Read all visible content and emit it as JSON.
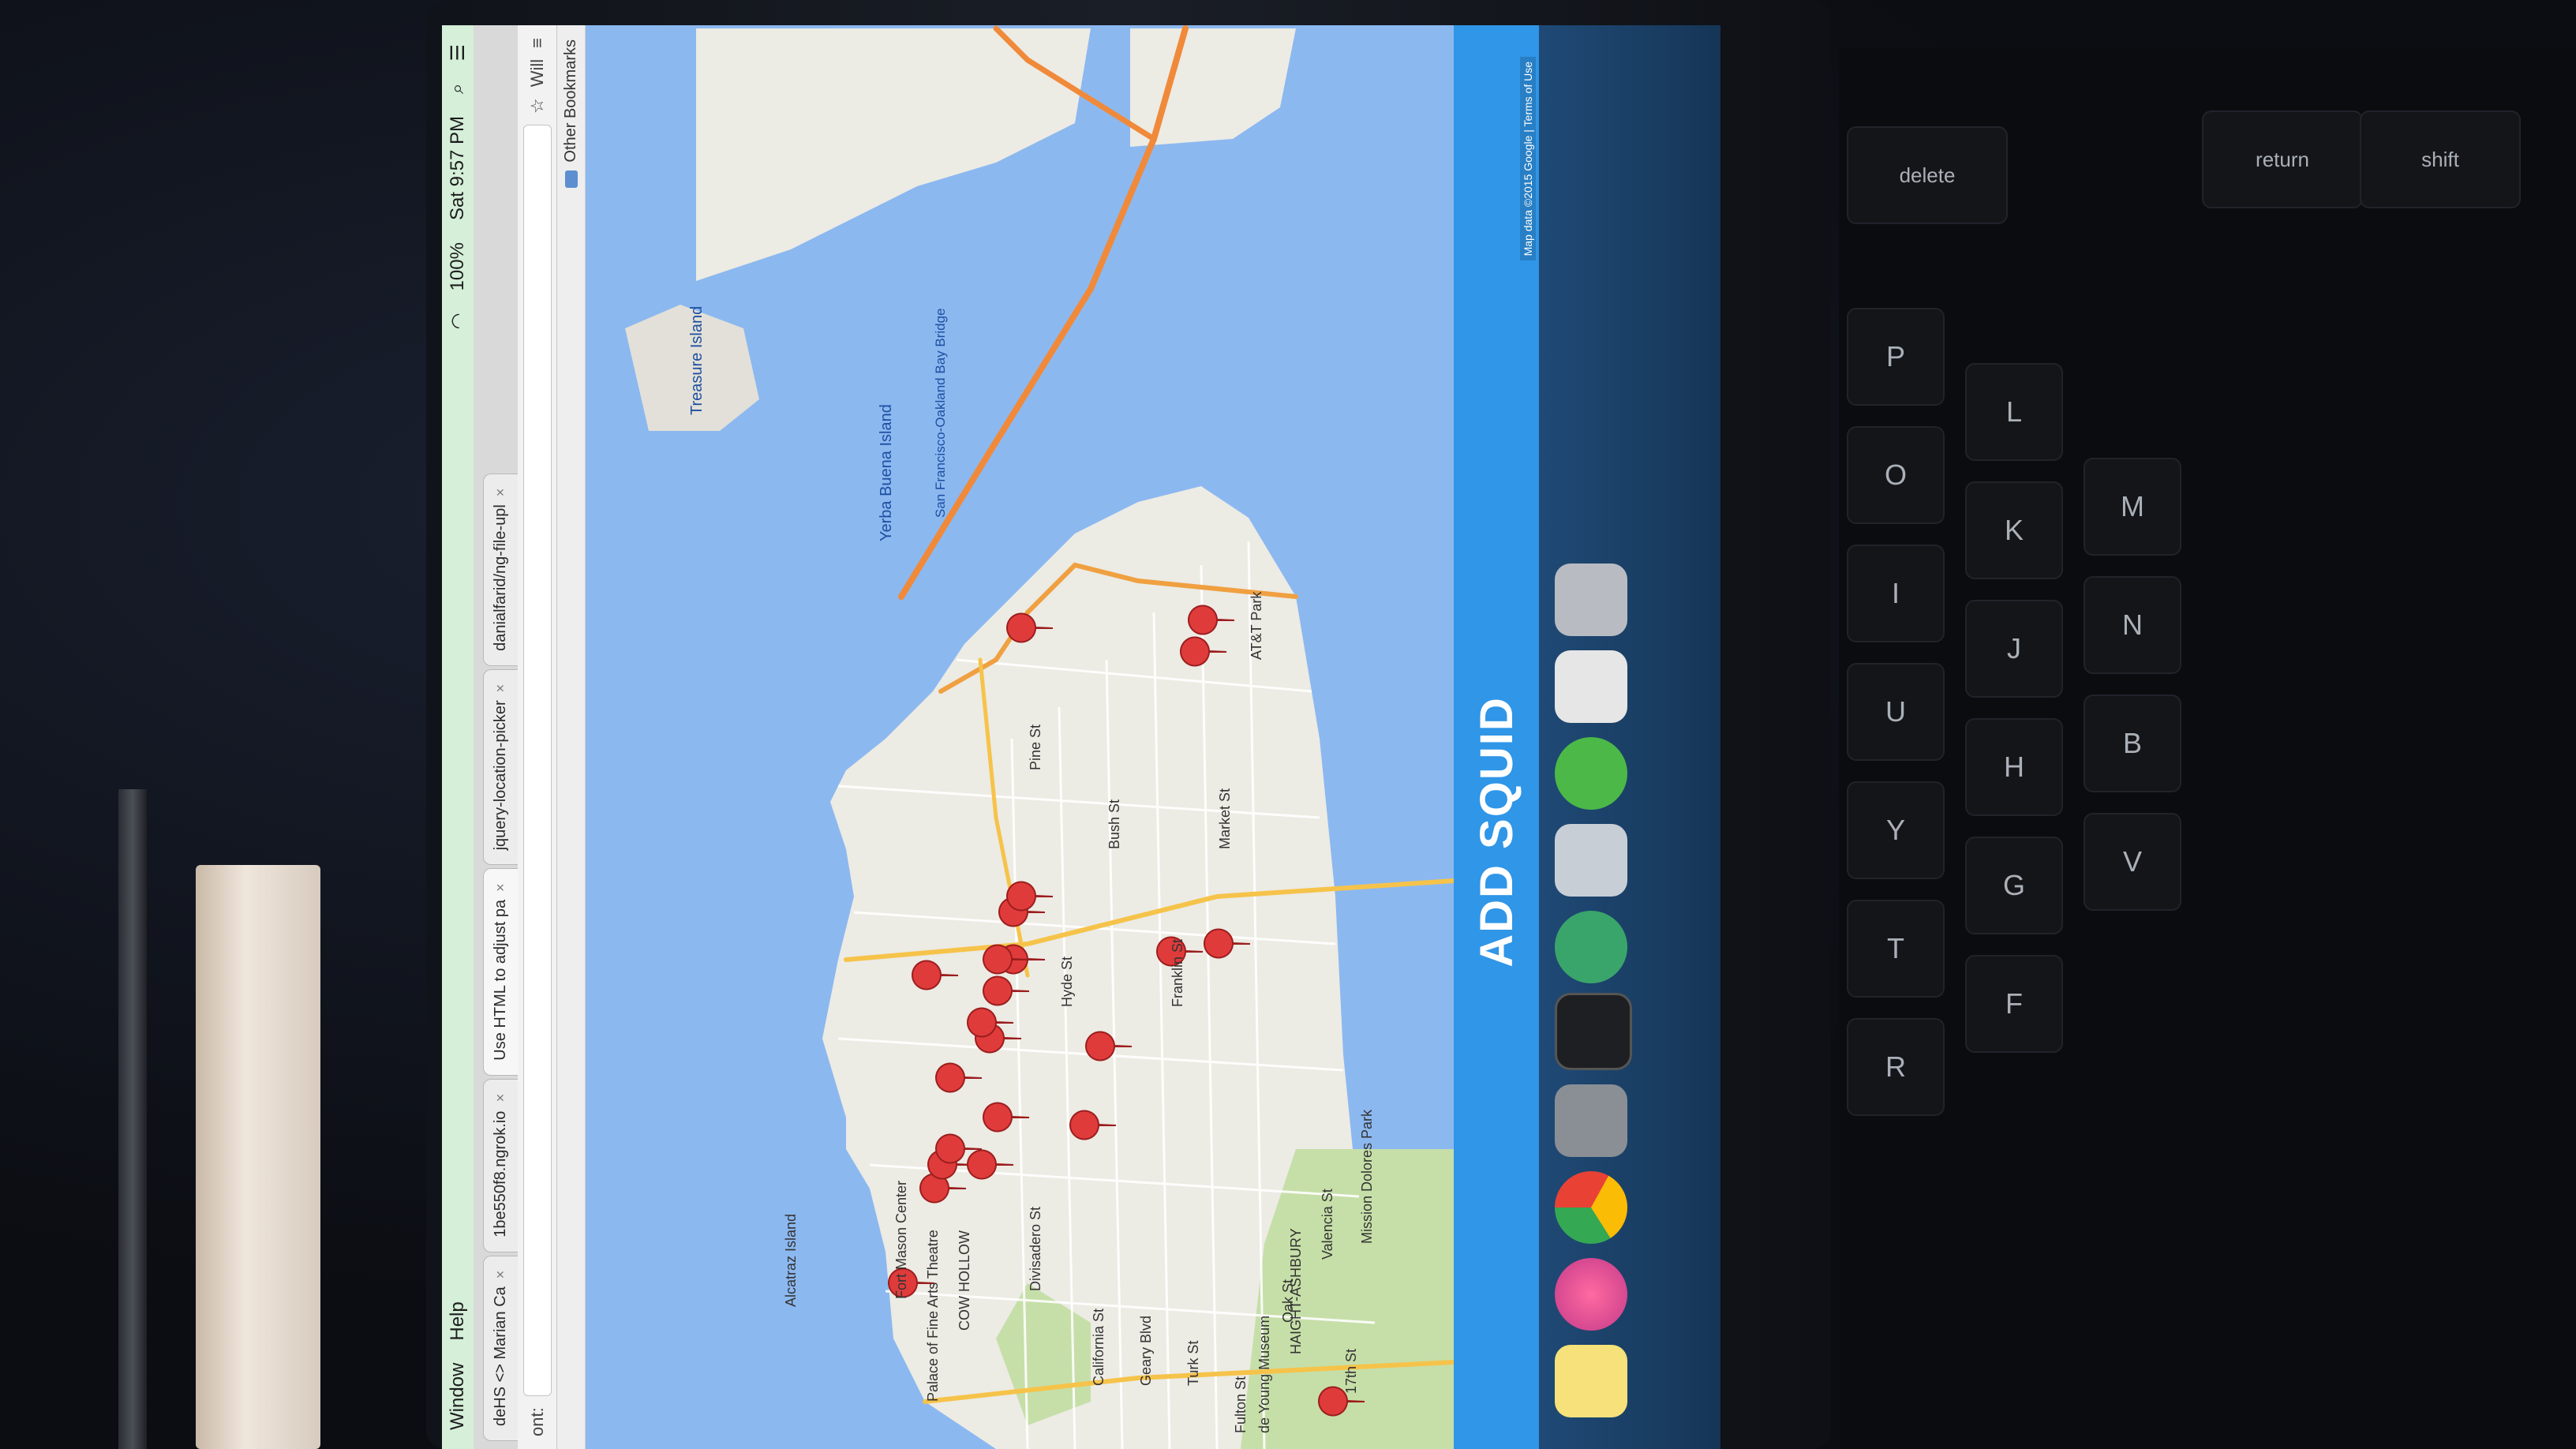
{
  "menubar": {
    "items": [
      "Window",
      "Help"
    ],
    "status": {
      "battery": "100%",
      "clock": "Sat 9:57 PM"
    }
  },
  "tabs": [
    {
      "label": "deHS <> Marian Ca"
    },
    {
      "label": "1be550f8.ngrok.io"
    },
    {
      "label": "Use HTML to adjust pa"
    },
    {
      "label": "jquery-location-picker"
    },
    {
      "label": "danialfarid/ng-file-upl"
    }
  ],
  "addressbar": {
    "left_text": "ont:",
    "right_text": "Will"
  },
  "bookmarks": {
    "label": "Other Bookmarks"
  },
  "map": {
    "water_labels": [
      "Treasure Island",
      "Yerba Buena Island",
      "San Francisco-Oakland Bay Bridge"
    ],
    "place_labels": [
      "Alcatraz Island",
      "Fort Mason Center",
      "Palace of Fine Arts Theatre",
      "Divisadero St",
      "California St",
      "Geary Blvd",
      "Turk St",
      "Fulton St",
      "de Young Museum",
      "Oak St",
      "Hyde St",
      "Pine St",
      "Bush St",
      "Franklin St",
      "Market St",
      "AT&T Park",
      "Mission Dolores Park",
      "Valencia St",
      "17th St",
      "COW HOLLOW",
      "HAIGHT-ASHBURY"
    ],
    "attribution": "Map data ©2015 Google | Terms of Use"
  },
  "add_button": {
    "label": "ADD SQUID"
  },
  "colors": {
    "map_water": "#8cb8f0",
    "accent_bar": "#2f96e8",
    "marker": "#e03b3b",
    "menubar": "#d5efd9"
  },
  "dock_icons": [
    "notes-icon",
    "itunes-icon",
    "chrome-icon",
    "system-prefs-icon",
    "terminal-icon",
    "atom-icon",
    "preview-icon",
    "utorrent-icon",
    "documents-icon",
    "trash-icon"
  ],
  "keyboard_keys": [
    "P",
    "O",
    "I",
    "U",
    "Y",
    "T",
    "R",
    "L",
    "K",
    "J",
    "H",
    "G",
    "F",
    "M",
    "N",
    "B",
    "V",
    "delete",
    "return",
    "shift"
  ]
}
